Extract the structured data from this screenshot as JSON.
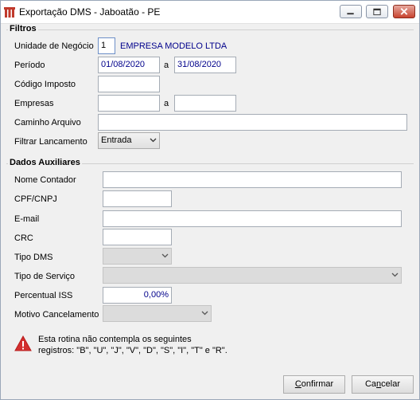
{
  "window": {
    "title": "Exportação DMS - Jaboatão - PE"
  },
  "filtros": {
    "group_title": "Filtros",
    "unidade_label": "Unidade de Negócio",
    "unidade_code": "1",
    "unidade_name": "EMPRESA MODELO LTDA",
    "periodo_label": "Período",
    "periodo_start": "01/08/2020",
    "periodo_sep": "a",
    "periodo_end": "31/08/2020",
    "codigo_label": "Código Imposto",
    "codigo_value": "",
    "empresas_label": "Empresas",
    "empresas_start": "",
    "empresas_sep": "a",
    "empresas_end": "",
    "caminho_label": "Caminho Arquivo",
    "caminho_value": "",
    "filtrar_label": "Filtrar Lancamento",
    "filtrar_value": "Entrada"
  },
  "auxiliares": {
    "group_title": "Dados Auxiliares",
    "nome_label": "Nome Contador",
    "nome_value": "",
    "cpf_label": "CPF/CNPJ",
    "cpf_value": "",
    "email_label": "E-mail",
    "email_value": "",
    "crc_label": "CRC",
    "crc_value": "",
    "tipo_dms_label": "Tipo DMS",
    "tipo_dms_value": "",
    "tipo_servico_label": "Tipo de Serviço",
    "tipo_servico_value": "",
    "percentual_label": "Percentual ISS",
    "percentual_value": "0,00%",
    "motivo_label": "Motivo Cancelamento",
    "motivo_value": ""
  },
  "warning": {
    "line1": "Esta rotina não contempla os seguintes",
    "line2": "registros: \"B\", \"U\", \"J\", \"V\", \"D\", \"S\", \"I\", \"T\" e \"R\"."
  },
  "buttons": {
    "confirmar_first": "C",
    "confirmar_rest": "onfirmar",
    "cancelar_first": "Ca",
    "cancelar_u": "n",
    "cancelar_rest": "celar"
  },
  "colors": {
    "accent_blue": "#00008b",
    "warning_red": "#d32f2f",
    "close_red": "#c8432f"
  }
}
